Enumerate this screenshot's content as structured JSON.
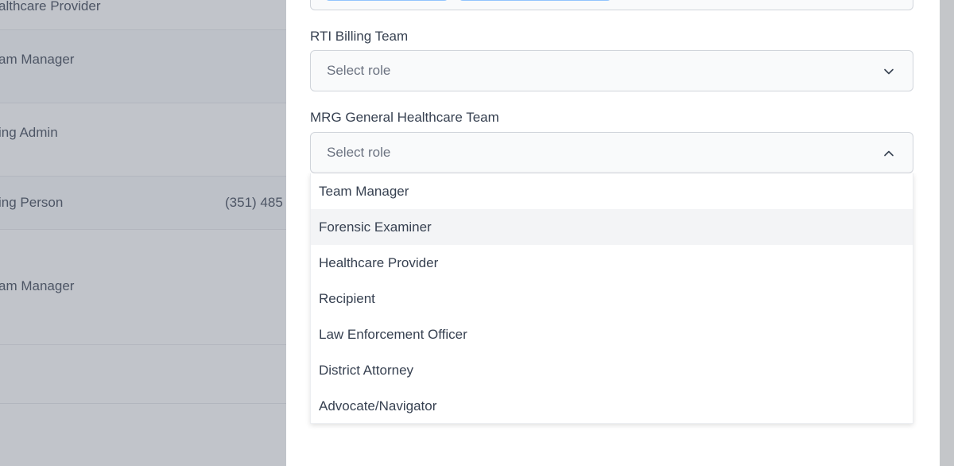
{
  "background_table": {
    "rows": [
      {
        "role": "althcare Provider",
        "phone": ""
      },
      {
        "role": "am Manager",
        "phone": ""
      },
      {
        "role": "ing Admin",
        "phone": ""
      },
      {
        "role": "ing Person",
        "phone": "(351) 485"
      },
      {
        "role": "am Manager",
        "phone": ""
      }
    ]
  },
  "form": {
    "rti_billing": {
      "label": "RTI Billing Team",
      "placeholder": "Select role"
    },
    "mrg_general": {
      "label": "MRG General Healthcare Team",
      "placeholder": "Select role"
    }
  },
  "dropdown": {
    "options": [
      "Team Manager",
      "Forensic Examiner",
      "Healthcare Provider",
      "Recipient",
      "Law Enforcement Officer",
      "District Attorney",
      "Advocate/Navigator"
    ],
    "highlighted": "Forensic Examiner"
  },
  "icons": {
    "rti_select": "chevron-down-icon",
    "mrg_select": "chevron-up-icon"
  },
  "colors": {
    "overlay": "#6b7280",
    "border": "#d1d5db",
    "hover": "#f3f4f6",
    "chip_border": "#93c5fd"
  }
}
